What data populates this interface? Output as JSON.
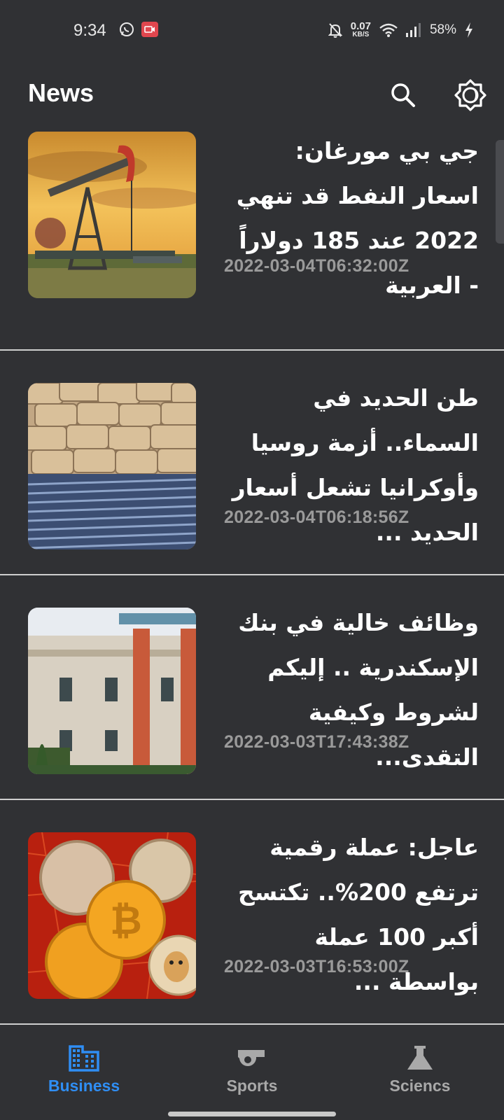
{
  "status_bar": {
    "time": "9:34",
    "net_speed_value": "0.07",
    "net_speed_unit": "KB/S",
    "battery": "58%"
  },
  "app_bar": {
    "title": "News",
    "icons": [
      "search-icon",
      "brightness-icon"
    ]
  },
  "articles": [
    {
      "headline": "جي بي مورغان: اسعار النفط قد تنهي 2022 عند 185 دولاراً - العربية",
      "timestamp": "2022-03-04T06:32:00Z",
      "image": "oil-pumpjack-sunset"
    },
    {
      "headline": "طن الحديد في السماء.. أزمة روسيا وأوكرانيا تشعل أسعار الحديد ...",
      "timestamp": "2022-03-04T06:18:56Z",
      "image": "cement-bags-steel-rebar"
    },
    {
      "headline": "وظائف خالية في بنك الإسكندرية .. إليكم لشروط وكيفية التقدى...",
      "timestamp": "2022-03-03T17:43:38Z",
      "image": "alexbank-building"
    },
    {
      "headline": "عاجل: عملة رقمية ترتفع 200%.. تكتسح أكبر 100 عملة بواسطة ...",
      "timestamp": "2022-03-03T16:53:00Z",
      "image": "crypto-coins"
    }
  ],
  "bottom_nav": {
    "items": [
      {
        "label": "Business",
        "icon": "business-building-icon",
        "active": true
      },
      {
        "label": "Sports",
        "icon": "whistle-icon",
        "active": false
      },
      {
        "label": "Sciencs",
        "icon": "flask-icon",
        "active": false
      }
    ],
    "active_color": "#2f8ef4",
    "inactive_color": "#a9a9a9"
  },
  "colors": {
    "background": "#303134",
    "divider": "#cfcfcf",
    "timestamp": "#9a9a9a"
  }
}
